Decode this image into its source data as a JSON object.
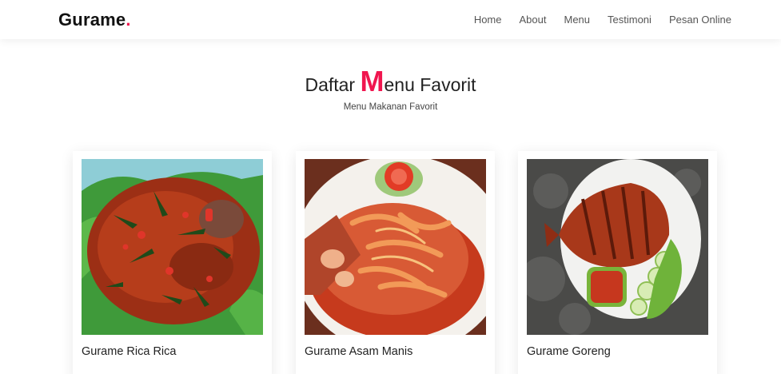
{
  "brand": {
    "name": "Gurame",
    "dot": "."
  },
  "nav": {
    "items": [
      {
        "label": "Home"
      },
      {
        "label": "About"
      },
      {
        "label": "Menu"
      },
      {
        "label": "Testimoni"
      },
      {
        "label": "Pesan Online"
      }
    ]
  },
  "section": {
    "title_before": "Daftar ",
    "title_accent": "M",
    "title_after": "enu Favorit",
    "subtitle": "Menu Makanan Favorit"
  },
  "menu": {
    "items": [
      {
        "name": "Gurame Rica Rica",
        "photo_icon": "gurame-rica-rica-photo"
      },
      {
        "name": "Gurame Asam Manis",
        "photo_icon": "gurame-asam-manis-photo"
      },
      {
        "name": "Gurame Goreng",
        "photo_icon": "gurame-goreng-photo"
      }
    ]
  },
  "colors": {
    "accent": "#f0164f",
    "text": "#222222",
    "nav_text": "#555555"
  }
}
